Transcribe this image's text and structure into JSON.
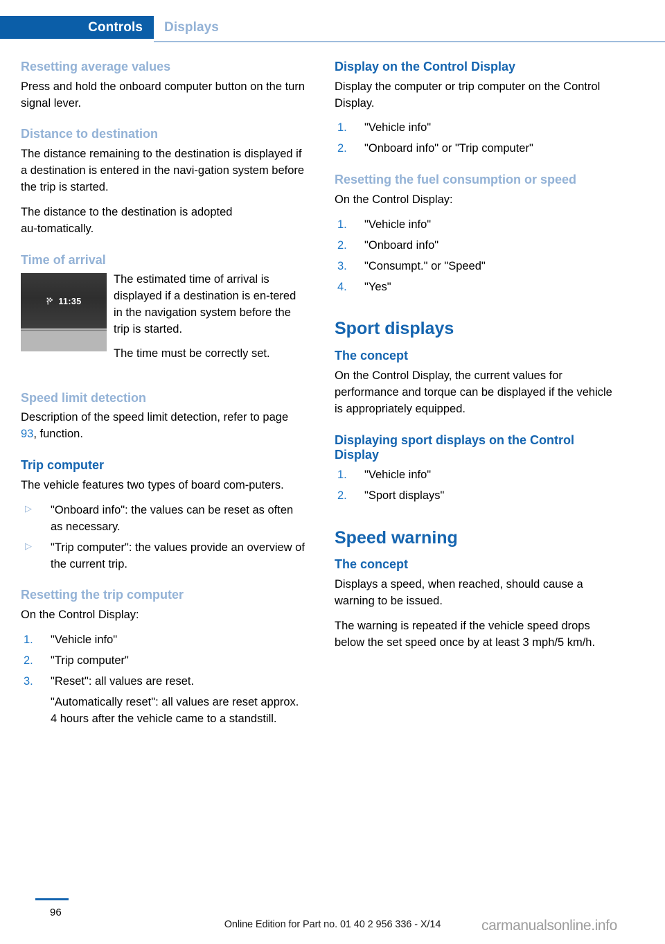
{
  "header": {
    "active_tab": "Controls",
    "inactive_tab": "Displays"
  },
  "left_column": {
    "s1": {
      "heading": "Resetting average values",
      "p1": "Press and hold the onboard computer button on the turn signal lever."
    },
    "s2": {
      "heading": "Distance to destination",
      "p1": "The distance remaining to the destination is displayed if a destination is entered in the navi‑gation system before the trip is started.",
      "p2": "The distance to the destination is adopted au‑tomatically."
    },
    "s3": {
      "heading": "Time of arrival",
      "figure": {
        "icon": "checkered-flag-icon",
        "time": "11:35"
      },
      "p1": "The estimated time of arrival is displayed if a destination is en‑tered in the navigation system before the trip is started.",
      "p2": "The time must be correctly set."
    },
    "s4": {
      "heading": "Speed limit detection",
      "p1_before": "Description of the speed limit detection, refer to page ",
      "p1_ref": "93",
      "p1_after": ", function."
    },
    "s5": {
      "heading": "Trip computer",
      "p1": "The vehicle features two types of board com‑puters.",
      "bullets": [
        {
          "marker": "▷",
          "text": "\"Onboard info\": the values can be reset as often as necessary."
        },
        {
          "marker": "▷",
          "text": "\"Trip computer\": the values provide an overview of the current trip."
        }
      ]
    },
    "s6": {
      "heading": "Resetting the trip computer",
      "p1": "On the Control Display:",
      "steps": [
        {
          "marker": "1.",
          "text": "\"Vehicle info\""
        },
        {
          "marker": "2.",
          "text": "\"Trip computer\""
        },
        {
          "marker": "3.",
          "text": "\"Reset\": all values are reset.",
          "continuation": "\"Automatically reset\": all values are reset approx. 4 hours after the vehicle came to a standstill."
        }
      ]
    }
  },
  "right_column": {
    "s1": {
      "heading": "Display on the Control Display",
      "p1": "Display the computer or trip computer on the Control Display.",
      "steps": [
        {
          "marker": "1.",
          "text": "\"Vehicle info\""
        },
        {
          "marker": "2.",
          "text": "\"Onboard info\" or \"Trip computer\""
        }
      ]
    },
    "s2": {
      "heading": "Resetting the fuel consumption or speed",
      "p1": "On the Control Display:",
      "steps": [
        {
          "marker": "1.",
          "text": "\"Vehicle info\""
        },
        {
          "marker": "2.",
          "text": "\"Onboard info\""
        },
        {
          "marker": "3.",
          "text": "\"Consumpt.\" or \"Speed\""
        },
        {
          "marker": "4.",
          "text": "\"Yes\""
        }
      ]
    },
    "s3": {
      "title": "Sport displays",
      "concept_heading": "The concept",
      "concept_p1": "On the Control Display, the current values for performance and torque can be displayed if the vehicle is appropriately equipped.",
      "sub_heading": "Displaying sport displays on the Control Display",
      "steps": [
        {
          "marker": "1.",
          "text": "\"Vehicle info\""
        },
        {
          "marker": "2.",
          "text": "\"Sport displays\""
        }
      ]
    },
    "s4": {
      "title": "Speed warning",
      "concept_heading": "The concept",
      "p1": "Displays a speed, when reached, should cause a warning to be issued.",
      "p2": "The warning is repeated if the vehicle speed drops below the set speed once by at least 3 mph/5 km/h."
    }
  },
  "footer": {
    "page_number": "96",
    "edition": "Online Edition for Part no. 01 40 2 956 336 - X/14",
    "watermark": "carmanualsonline.info"
  },
  "colors": {
    "tab_blue": "#0B5EA8",
    "heading_dark_blue": "#1565B0",
    "heading_light_blue": "#93B2D6",
    "link_blue": "#1E78C8"
  }
}
